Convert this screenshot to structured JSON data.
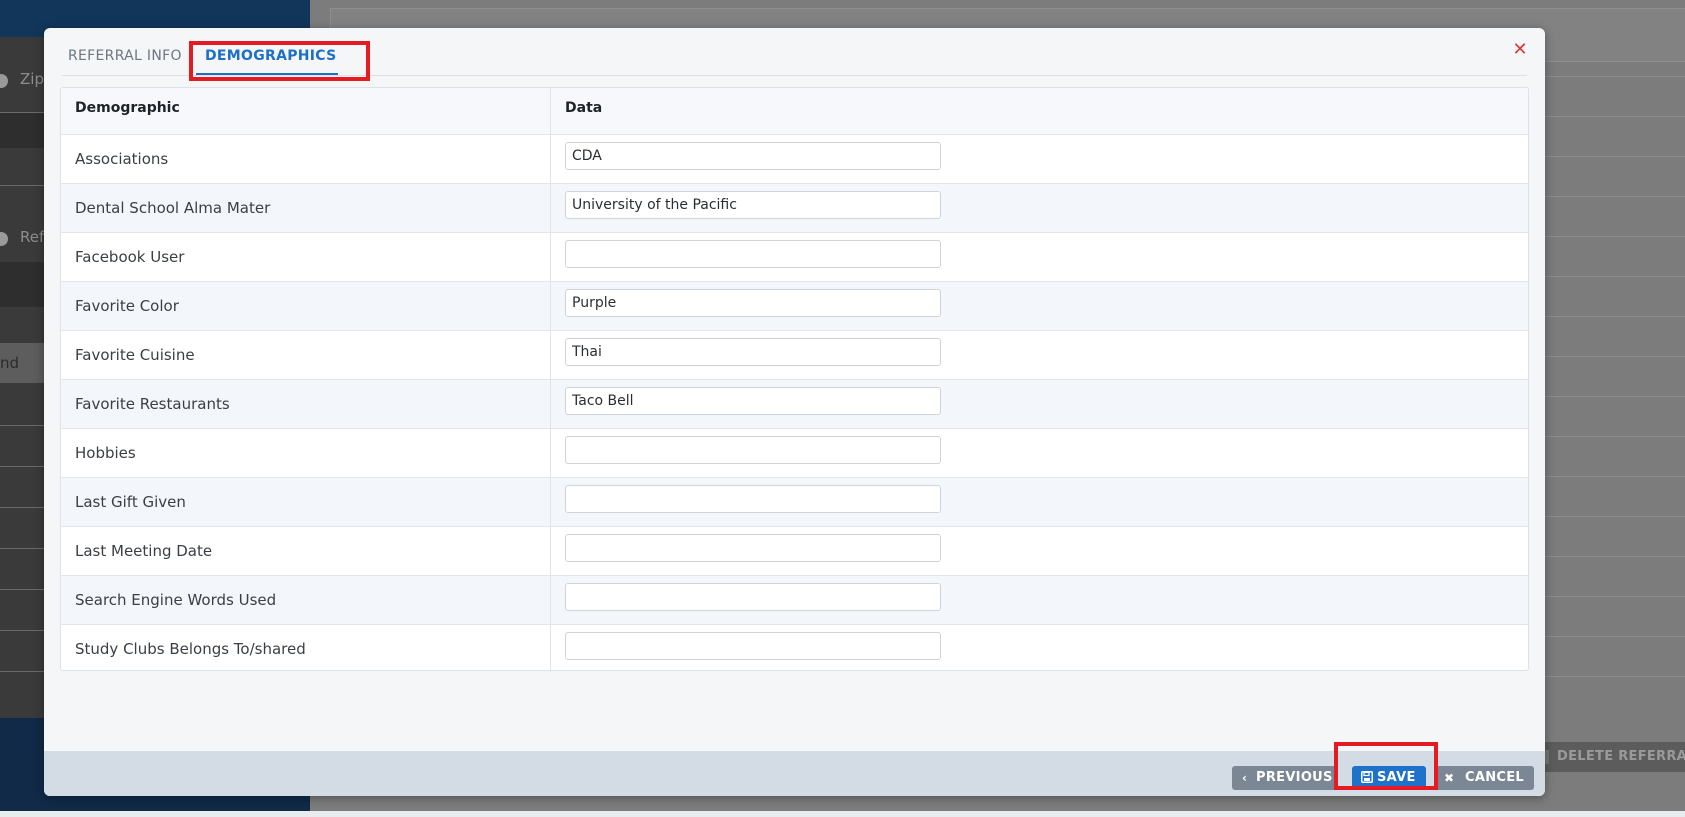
{
  "background": {
    "left_labels": [
      "Zip",
      "Ref"
    ],
    "column_header_fragment": "nd",
    "delete_button_label": "DELETE REFERRA"
  },
  "modal": {
    "tabs": [
      {
        "label": "REFERRAL INFO",
        "active": false
      },
      {
        "label": "DEMOGRAPHICS",
        "active": true
      }
    ],
    "close_icon": "close-icon",
    "table": {
      "headers": {
        "demographic": "Demographic",
        "data": "Data"
      },
      "rows": [
        {
          "name": "Associations",
          "value": ""
        },
        {
          "name": "Dental School Alma Mater",
          "value": ""
        },
        {
          "name": "Facebook User",
          "value": ""
        },
        {
          "name": "Favorite Color",
          "value": ""
        },
        {
          "name": "Favorite Cuisine",
          "value": ""
        },
        {
          "name": "Favorite Restaurants",
          "value": ""
        },
        {
          "name": "Hobbies",
          "value": ""
        },
        {
          "name": "Last Gift Given",
          "value": ""
        },
        {
          "name": "Last Meeting Date",
          "value": ""
        },
        {
          "name": "Search Engine Words Used",
          "value": ""
        },
        {
          "name": "Study Clubs Belongs To/shared",
          "value": ""
        }
      ]
    },
    "footer": {
      "previous_label": "PREVIOUS",
      "save_label": "SAVE",
      "cancel_label": "CANCEL"
    }
  },
  "values": [
    "CDA",
    "University of the Pacific",
    "",
    "Purple",
    "Thai",
    "Taco Bell",
    "",
    "",
    "",
    "",
    ""
  ],
  "colors": {
    "accent": "#1d6fc7",
    "highlight": "#e41b23",
    "close": "#d9383f",
    "secondary_button": "#7b8794"
  }
}
